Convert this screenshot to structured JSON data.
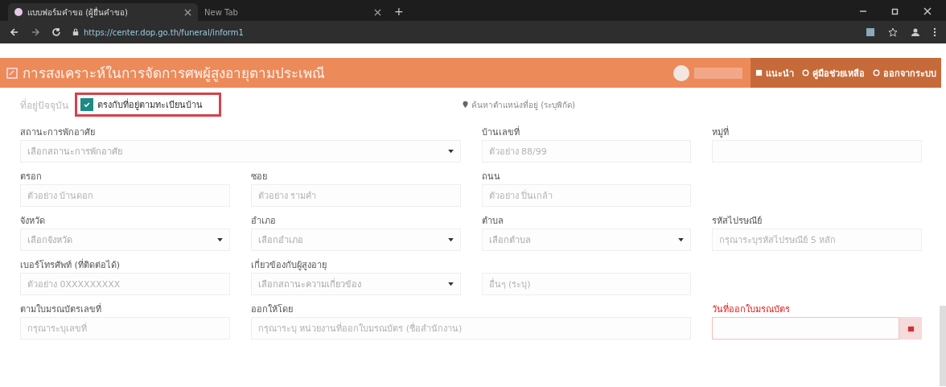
{
  "browser": {
    "tabs": [
      {
        "title": "แบบฟอร์มคำขอ (ผู้ยื่นคำขอ)",
        "selected": true
      },
      {
        "title": "New Tab",
        "selected": false
      }
    ],
    "new_tab": "+",
    "url": "https://center.dop.go.th/funeral/inform1"
  },
  "header": {
    "title": "การสงเคราะห์ในการจัดการศพผู้สูงอายุตามประเพณี",
    "nav": [
      "แนะนำ",
      "คู่มือช่วยเหลือ",
      "ออกจากระบบ"
    ]
  },
  "address": {
    "label": "ที่อยู่ปัจจุบัน",
    "same_as_registered": {
      "label": "ตรงกับที่อยู่ตามทะเบียนบ้าน",
      "checked": true
    },
    "map_link": "ค้นหาตำแหน่งที่อยู่ (ระบุพิกัด)"
  },
  "rows": [
    [
      {
        "label": "สถานะการพักอาศัย",
        "kind": "select",
        "placeholder": "เลือกสถานะการพักอาศัย",
        "wide": true
      },
      {
        "label": "บ้านเลขที่",
        "kind": "input",
        "placeholder": "ตัวอย่าง 88/99"
      },
      {
        "label": "หมู่ที่",
        "kind": "input"
      }
    ],
    [
      {
        "label": "ตรอก",
        "kind": "input",
        "placeholder": "ตัวอย่าง บ้านดอก"
      },
      {
        "label": "ซอย",
        "kind": "input",
        "placeholder": "ตัวอย่าง รามคำ"
      },
      {
        "label": "ถนน",
        "kind": "input",
        "placeholder": "ตัวอย่าง ปิ่นเกล้า"
      }
    ],
    [
      {
        "label": "จังหวัด",
        "kind": "select",
        "placeholder": "เลือกจังหวัด"
      },
      {
        "label": "อำเภอ",
        "kind": "select",
        "placeholder": "เลือกอำเภอ"
      },
      {
        "label": "ตำบล",
        "kind": "select",
        "placeholder": "เลือกตำบล"
      },
      {
        "label": "รหัสไปรษณีย์",
        "kind": "input",
        "placeholder": "กรุณาระบุรหัสไปรษณีย์ 5 หลัก"
      }
    ],
    [
      {
        "label": "เบอร์โทรศัพท์ (ที่ติดต่อได้)",
        "kind": "input",
        "placeholder": "ตัวอย่าง 0XXXXXXXXX"
      },
      {
        "label": "เกี่ยวข้องกับผู้สูงอายุ",
        "kind": "select",
        "placeholder": "เลือกสถานะความเกี่ยวข้อง"
      },
      {
        "kind": "input",
        "placeholder": "อื่นๆ (ระบุ)"
      }
    ],
    [
      {
        "label": "ตามใบมรณบัตรเลขที่",
        "kind": "input",
        "placeholder": "กรุณาระบุเลขที่"
      },
      {
        "label": "ออกให้โดย",
        "kind": "input",
        "placeholder": "กรุณาระบุ หน่วยงานที่ออกใบมรณบัตร (ชื่อสำนักงาน)",
        "wide": true
      },
      {
        "label": "วันที่ออกใบมรณบัตร",
        "kind": "date",
        "alert": true
      }
    ]
  ]
}
